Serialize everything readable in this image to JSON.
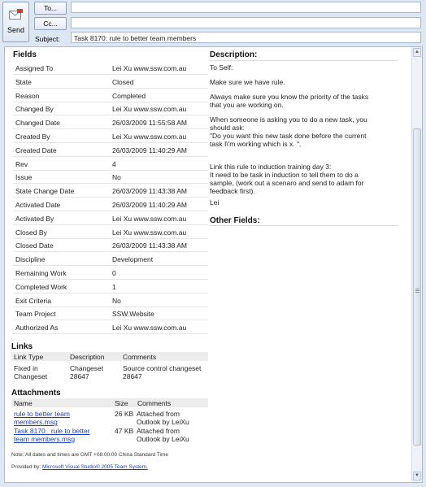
{
  "header": {
    "send_label": "Send",
    "to_label": "To...",
    "cc_label": "Cc...",
    "subject_label": "Subject:",
    "subject_value": "Task 8170: rule to better team members"
  },
  "fields": {
    "title": "Fields",
    "rows": [
      {
        "name": "Assigned To",
        "value": "Lei Xu www.ssw.com.au"
      },
      {
        "name": "State",
        "value": "Closed"
      },
      {
        "name": "Reason",
        "value": "Completed"
      },
      {
        "name": "Changed By",
        "value": "Lei Xu www.ssw.com.au"
      },
      {
        "name": "Changed Date",
        "value": "26/03/2009 11:55:58 AM"
      },
      {
        "name": "Created By",
        "value": "Lei Xu www.ssw.com.au"
      },
      {
        "name": "Created Date",
        "value": "26/03/2009 11:40:29 AM"
      },
      {
        "name": "Rev",
        "value": "4"
      },
      {
        "name": "Issue",
        "value": "No"
      },
      {
        "name": "State Change Date",
        "value": "26/03/2009 11:43:38 AM"
      },
      {
        "name": "Activated Date",
        "value": "26/03/2009 11:40:29 AM"
      },
      {
        "name": "Activated By",
        "value": "Lei Xu www.ssw.com.au"
      },
      {
        "name": "Closed By",
        "value": "Lei Xu www.ssw.com.au"
      },
      {
        "name": "Closed Date",
        "value": "26/03/2009 11:43:38 AM"
      },
      {
        "name": "Discipline",
        "value": "Development"
      },
      {
        "name": "Remaining Work",
        "value": "0"
      },
      {
        "name": "Completed Work",
        "value": "1"
      },
      {
        "name": "Exit Criteria",
        "value": "No"
      },
      {
        "name": "Team Project",
        "value": "SSW.Website"
      },
      {
        "name": "Authorized As",
        "value": "Lei Xu www.ssw.com.au"
      }
    ]
  },
  "description": {
    "title": "Description:",
    "lines": [
      "To Self:",
      "Make sure we have rule.",
      "Always make sure you know the priority of the tasks",
      "that you are working on.",
      "When someone is asking you to do a new task, you",
      "should ask:",
      "\"Do you want this new task done before the current",
      "task I\\'m working which is x. \".",
      "Link this rule to induction training day 3:",
      "It need to be task in induction to tell them to do a",
      "sample, (work out a scenaro and send to adam for",
      "feedback first).",
      "Lei"
    ]
  },
  "other_fields": {
    "title": "Other Fields:"
  },
  "links": {
    "title": "Links",
    "headers": [
      "Link Type",
      "Description",
      "Comments"
    ],
    "rows": [
      {
        "type_line1": "Fixed in",
        "type_line2": "Changeset",
        "desc_line1": "Changeset",
        "desc_line2": "28647",
        "comment_line1": "Source control changeset",
        "comment_line2": "28647"
      }
    ]
  },
  "attachments": {
    "title": "Attachments",
    "headers": [
      "Name",
      "Size",
      "Comments"
    ],
    "rows": [
      {
        "name_line1": "rule to better team",
        "name_line2": "members.msg",
        "size": "26 KB",
        "comment_line1": "Attached from",
        "comment_line2": "Outlook by LeiXu"
      },
      {
        "name_line1": "Task 8170_ rule to better",
        "name_line2": "team members.msg",
        "size": "47 KB",
        "comment_line1": "Attached from",
        "comment_line2": "Outlook by LeiXu"
      }
    ]
  },
  "footer": {
    "note": "Note: All dates and times are GMT +08:00:00 China Standard Time",
    "provided_prefix": "Provided by:",
    "provided_link": "Microsoft Visual Studio® 2005 Team System."
  }
}
